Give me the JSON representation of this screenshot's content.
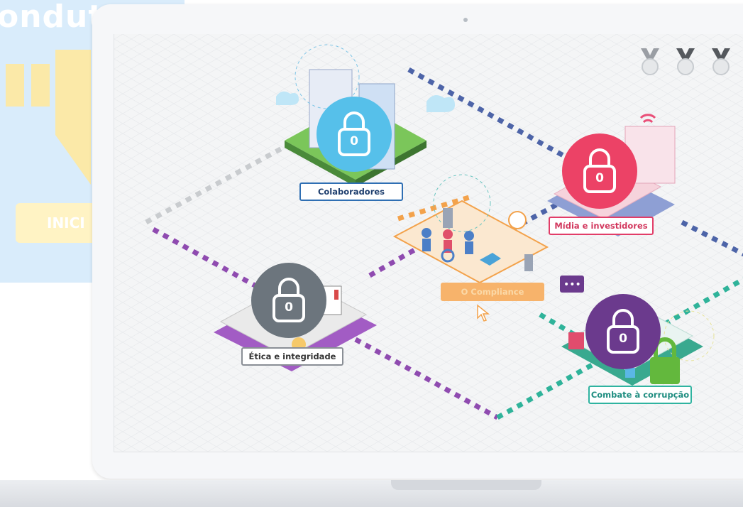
{
  "background": {
    "title_fragment": "onduta",
    "button_fragment": "INICI"
  },
  "badges": [
    {
      "name": "badge-1",
      "icon": "medal-icon"
    },
    {
      "name": "badge-2",
      "icon": "medal-icon"
    },
    {
      "name": "badge-3",
      "icon": "medal-icon"
    }
  ],
  "stations": {
    "colaboradores": {
      "label": "Colaboradores",
      "count": "0",
      "color": "#56c0ea",
      "border": "#2f6fb3"
    },
    "midia": {
      "label": "Mídia e investidores",
      "count": "0",
      "color": "#ec4266",
      "border": "#e23d68"
    },
    "compliance": {
      "label": "O Compliance",
      "color": "#f7b36b"
    },
    "etica": {
      "label": "Ética e integridade",
      "count": "0",
      "color": "#6c757d",
      "border": "#8a8f96"
    },
    "combate": {
      "label": "Combate à corrupção",
      "count": "0",
      "color": "#6b3a8d",
      "border": "#2fb3a0"
    }
  }
}
